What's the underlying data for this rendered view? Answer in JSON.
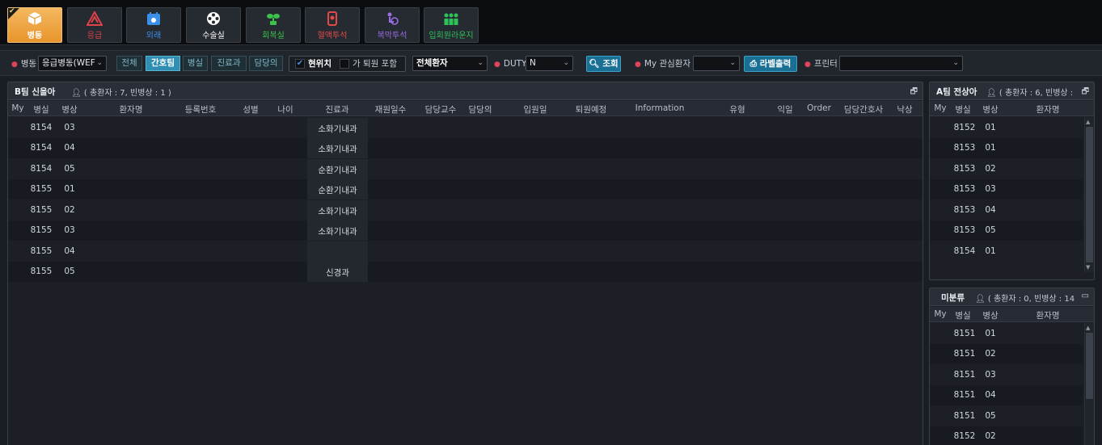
{
  "nav": {
    "items": [
      {
        "label": "병동",
        "icon": "cube-icon",
        "color": "#ffffff",
        "active": true
      },
      {
        "label": "응급",
        "icon": "emergency-icon",
        "color": "#e0424a"
      },
      {
        "label": "외래",
        "icon": "calendar-clinic-icon",
        "color": "#3a8fe8"
      },
      {
        "label": "수술실",
        "icon": "film-reel-icon",
        "color": "#ffffff"
      },
      {
        "label": "회복실",
        "icon": "plant-icon",
        "color": "#3cc24b"
      },
      {
        "label": "혈액투석",
        "icon": "dialysis-icon",
        "color": "#e24a4a"
      },
      {
        "label": "복막투석",
        "icon": "peritoneal-icon",
        "color": "#9a6ee6"
      },
      {
        "label": "입회원라운지",
        "icon": "group-icon",
        "color": "#2ec25a"
      }
    ]
  },
  "toolbar": {
    "ward_label": "병동",
    "ward_value": "응급병동(WEF",
    "segments": [
      {
        "label": "전체",
        "on": false
      },
      {
        "label": "간호팀",
        "on": true
      },
      {
        "label": "병실",
        "on": false
      },
      {
        "label": "진료과",
        "on": false
      },
      {
        "label": "담당의",
        "on": false
      }
    ],
    "current_location_label": "현위치",
    "include_label": "가 퇴원 포함",
    "patient_filter_value": "전체환자",
    "duty_label": "DUTY",
    "duty_value": "N",
    "search_label": "조회",
    "my_patient_label": "My 관심환자",
    "label_print_label": "라벨출력",
    "printer_label": "프린터"
  },
  "main_panel": {
    "title": "B팀 신을아",
    "summary": "( 총환자 : 7, 빈병상 : 1 )",
    "columns": [
      "My",
      "병실",
      "병상",
      "환자명",
      "등록번호",
      "성별",
      "나이",
      "진료과",
      "재원일수",
      "담당교수",
      "담당의",
      "입원일",
      "퇴원예정",
      "Information",
      "유형",
      "익일",
      "Order",
      "담당간호사",
      "낙상"
    ],
    "rows": [
      {
        "room": "8154",
        "bed": "03",
        "dept": "소화기내과"
      },
      {
        "room": "8154",
        "bed": "04",
        "dept": "소화기내과"
      },
      {
        "room": "8154",
        "bed": "05",
        "dept": "순환기내과"
      },
      {
        "room": "8155",
        "bed": "01",
        "dept": "순환기내과"
      },
      {
        "room": "8155",
        "bed": "02",
        "dept": "소화기내과"
      },
      {
        "room": "8155",
        "bed": "03",
        "dept": "소화기내과"
      },
      {
        "room": "8155",
        "bed": "04",
        "dept": ""
      },
      {
        "room": "8155",
        "bed": "05",
        "dept": "신경과"
      }
    ]
  },
  "team_a_panel": {
    "title": "A팀 전상아",
    "summary": "( 총환자 : 6, 빈병상 :",
    "columns": [
      "My",
      "병실",
      "병상",
      "환자명"
    ],
    "rows": [
      {
        "room": "8152",
        "bed": "01"
      },
      {
        "room": "8153",
        "bed": "01"
      },
      {
        "room": "8153",
        "bed": "02"
      },
      {
        "room": "8153",
        "bed": "03"
      },
      {
        "room": "8153",
        "bed": "04"
      },
      {
        "room": "8153",
        "bed": "05"
      },
      {
        "room": "8154",
        "bed": "01"
      }
    ]
  },
  "unassigned_panel": {
    "title": "미분류",
    "summary": "( 총환자 : 0, 빈병상 : 14",
    "columns": [
      "My",
      "병실",
      "병상",
      "환자명"
    ],
    "rows": [
      {
        "room": "8151",
        "bed": "01"
      },
      {
        "room": "8151",
        "bed": "02"
      },
      {
        "room": "8151",
        "bed": "03"
      },
      {
        "room": "8151",
        "bed": "04"
      },
      {
        "room": "8151",
        "bed": "05"
      },
      {
        "room": "8152",
        "bed": "02"
      }
    ]
  }
}
